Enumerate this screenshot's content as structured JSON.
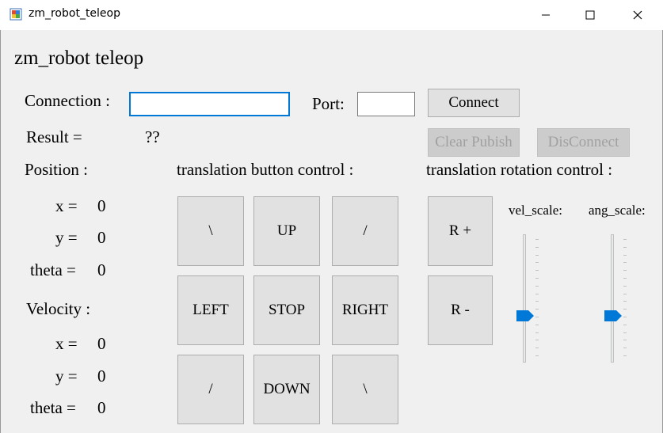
{
  "window": {
    "title": "zm_robot_teleop",
    "controls": {
      "minimize": "minimize-icon",
      "maximize": "maximize-icon",
      "close": "close-icon"
    }
  },
  "app_title": "zm_robot teleop",
  "connection": {
    "label": "Connection :",
    "value": "",
    "port_label": "Port:",
    "port_value": "",
    "connect_button": "Connect",
    "clear_button": "Clear Pubish",
    "disconnect_button": "DisConnect"
  },
  "result": {
    "label": "Result =",
    "value": "??"
  },
  "position": {
    "label": "Position :",
    "x_label": "x =",
    "x_value": "0",
    "y_label": "y =",
    "y_value": "0",
    "theta_label": "theta =",
    "theta_value": "0"
  },
  "velocity": {
    "label": "Velocity :",
    "x_label": "x =",
    "x_value": "0",
    "y_label": "y =",
    "y_value": "0",
    "theta_label": "theta =",
    "theta_value": "0"
  },
  "translation": {
    "label": "translation button control :",
    "buttons": [
      "\\",
      "UP",
      "/",
      "LEFT",
      "STOP",
      "RIGHT",
      "/",
      "DOWN",
      "\\"
    ]
  },
  "rotation": {
    "label": "translation rotation control :",
    "r_plus": "R +",
    "r_minus": "R -",
    "vel_scale_label": "vel_scale:",
    "ang_scale_label": "ang_scale:",
    "vel_scale_level": 0.35,
    "ang_scale_level": 0.35
  },
  "colors": {
    "accent": "#0078d7",
    "disabled_text": "#a0a0a0"
  }
}
